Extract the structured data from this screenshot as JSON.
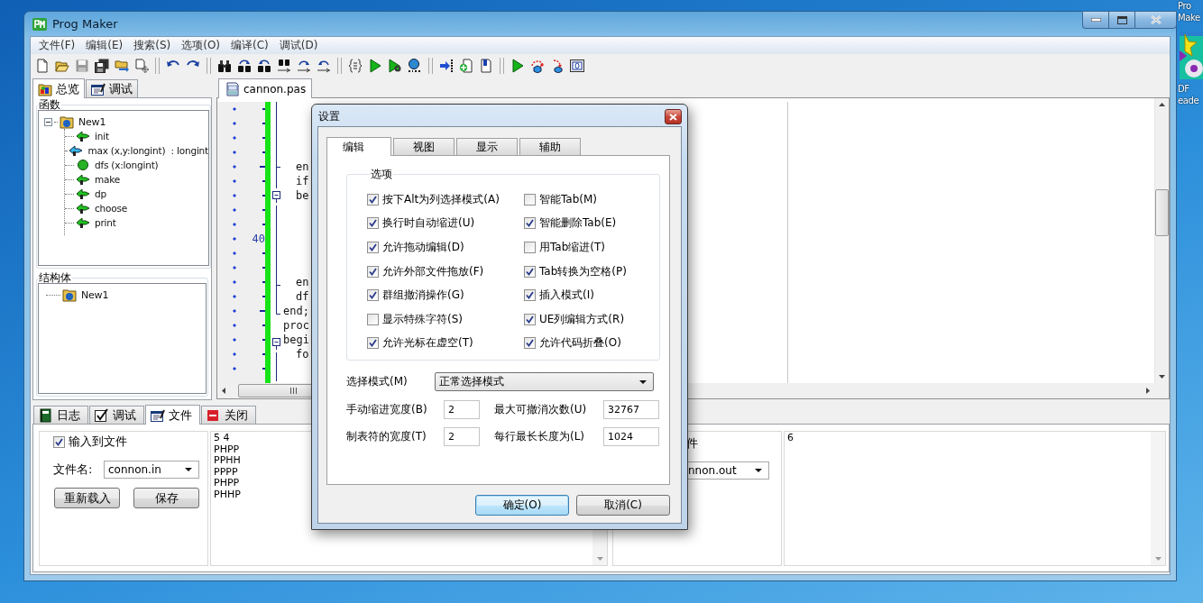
{
  "desktop": {
    "icons": [
      {
        "lines": [
          "Pro",
          "Make"
        ],
        "kind": "text"
      },
      {
        "lines": [
          "DF",
          "eade"
        ],
        "kind": "app"
      }
    ]
  },
  "window": {
    "title": "Prog Maker"
  },
  "menu": [
    "文件(F)",
    "编辑(E)",
    "搜索(S)",
    "选项(O)",
    "编译(C)",
    "调试(D)"
  ],
  "toolbar": [
    [
      {
        "kind": "new",
        "disabled": false
      },
      {
        "kind": "open",
        "disabled": false
      },
      {
        "kind": "save",
        "disabled": true
      },
      {
        "kind": "saveall",
        "disabled": false
      },
      {
        "kind": "export",
        "disabled": false
      },
      {
        "kind": "pagecursor",
        "disabled": false
      }
    ],
    [
      {
        "kind": "undo",
        "disabled": false
      },
      {
        "kind": "redo",
        "disabled": false
      }
    ],
    [
      {
        "kind": "find",
        "disabled": false
      },
      {
        "kind": "findnext",
        "disabled": false
      },
      {
        "kind": "findprev",
        "disabled": false
      },
      {
        "kind": "replace",
        "disabled": false
      },
      {
        "kind": "replacenext",
        "disabled": false
      },
      {
        "kind": "replaceprev",
        "disabled": false
      }
    ],
    [
      {
        "kind": "format",
        "disabled": false
      },
      {
        "kind": "run",
        "disabled": false
      },
      {
        "kind": "compile",
        "disabled": false
      },
      {
        "kind": "build",
        "disabled": false
      }
    ],
    [
      {
        "kind": "stepin",
        "disabled": false
      },
      {
        "kind": "addpage",
        "disabled": false
      },
      {
        "kind": "bookmark",
        "disabled": false
      }
    ],
    [
      {
        "kind": "run",
        "disabled": false
      },
      {
        "kind": "stepover",
        "disabled": false
      },
      {
        "kind": "stepdown",
        "disabled": false
      },
      {
        "kind": "window",
        "disabled": false
      }
    ]
  ],
  "left_panel": {
    "tabs": [
      {
        "label": "总览",
        "kind": "overview",
        "selected": true
      },
      {
        "label": "调试",
        "kind": "debug",
        "selected": false
      }
    ],
    "groups": [
      {
        "title": "函数",
        "tree": [
          {
            "label": "New1",
            "expanded": true,
            "children": [
              {
                "label": "init",
                "kind": "procedure"
              },
              {
                "label": "max (x,y:longint)  : longint",
                "kind": "function"
              },
              {
                "label": "dfs (x:longint)",
                "kind": "forward"
              },
              {
                "label": "make",
                "kind": "procedure"
              },
              {
                "label": "dp",
                "kind": "procedure"
              },
              {
                "label": "choose",
                "kind": "procedure"
              },
              {
                "label": "print",
                "kind": "procedure"
              }
            ]
          }
        ]
      },
      {
        "title": "结构体",
        "tree": [
          {
            "label": "New1"
          }
        ]
      }
    ]
  },
  "editor": {
    "tabs": [
      {
        "label": "cannon.pas",
        "selected": true
      }
    ],
    "lines": [
      {
        "long_dash": false,
        "kind": "inner"
      },
      {
        "long_dash": false,
        "kind": "inner"
      },
      {
        "long_dash": false,
        "kind": "inner"
      },
      {
        "long_dash": false,
        "kind": "inner"
      },
      {
        "long_dash": true,
        "kind": "branch",
        "text": "en",
        "indented": true
      },
      {
        "long_dash": false,
        "kind": "inner",
        "text": "if",
        "indented": true
      },
      {
        "long_dash": false,
        "kind": "foldstart",
        "text": "be",
        "indented": true
      },
      {
        "long_dash": false,
        "kind": "inner"
      },
      {
        "long_dash": false,
        "kind": "inner"
      },
      {
        "number": "40",
        "kind": "inner"
      },
      {
        "long_dash": false,
        "kind": "inner"
      },
      {
        "long_dash": false,
        "kind": "inner"
      },
      {
        "long_dash": false,
        "kind": "branch",
        "text": "en",
        "indented": true
      },
      {
        "long_dash": false,
        "kind": "inner",
        "text": "df",
        "indented": true
      },
      {
        "long_dash": true,
        "kind": "foldend",
        "text": "end;",
        "indented": false
      },
      {
        "long_dash": false,
        "kind": "plain",
        "text": "proc",
        "indented": false
      },
      {
        "long_dash": false,
        "kind": "foldstart",
        "text": "begi",
        "indented": false
      },
      {
        "long_dash": false,
        "kind": "inner",
        "text": "fo",
        "indented": true
      },
      {
        "long_dash": false,
        "kind": "inner"
      }
    ]
  },
  "bottom_panel": {
    "tabs": [
      {
        "label": "日志",
        "kind": "log",
        "selected": false
      },
      {
        "label": "调试",
        "kind": "debug",
        "selected": false
      },
      {
        "label": "文件",
        "kind": "file",
        "selected": true
      },
      {
        "label": "关闭",
        "kind": "close",
        "selected": false
      }
    ],
    "input": {
      "checkbox": {
        "label": "输入到文件",
        "checked": true
      },
      "filename_label": "文件名:",
      "filename": "connon.in",
      "buttons": [
        "重新载入",
        "保存"
      ],
      "content": [
        "5 4",
        "PHPP",
        "PPHH",
        "PPPP",
        "PHPP",
        "PHHP"
      ]
    },
    "output": {
      "label": "件",
      "filename": "nnon.out",
      "content": [
        "6"
      ]
    }
  },
  "dialog": {
    "title": "设置",
    "tabs": [
      {
        "label": "编辑",
        "selected": true
      },
      {
        "label": "视图",
        "selected": false
      },
      {
        "label": "显示",
        "selected": false
      },
      {
        "label": "辅助",
        "selected": false
      }
    ],
    "group_title": "选项",
    "options": [
      {
        "label": "按下Alt为列选择模式(A)",
        "checked": true
      },
      {
        "label": "智能Tab(M)",
        "checked": false
      },
      {
        "label": "换行时自动缩进(U)",
        "checked": true
      },
      {
        "label": "智能删除Tab(E)",
        "checked": true
      },
      {
        "label": "允许拖动编辑(D)",
        "checked": true
      },
      {
        "label": "用Tab缩进(T)",
        "checked": false
      },
      {
        "label": "允许外部文件拖放(F)",
        "checked": true
      },
      {
        "label": "Tab转换为空格(P)",
        "checked": true
      },
      {
        "label": "群组撤消操作(G)",
        "checked": true
      },
      {
        "label": "插入模式(I)",
        "checked": true
      },
      {
        "label": "显示特殊字符(S)",
        "checked": false
      },
      {
        "label": "UE列编辑方式(R)",
        "checked": true
      },
      {
        "label": "允许光标在虚空(T)",
        "checked": true
      },
      {
        "label": "允许代码折叠(O)",
        "checked": true
      }
    ],
    "select_mode": {
      "label": "选择模式(M)",
      "value": "正常选择模式"
    },
    "fields": [
      {
        "label": "手动缩进宽度(B)",
        "value": "2"
      },
      {
        "label": "最大可撤消次数(U)",
        "value": "32767"
      },
      {
        "label": "制表符的宽度(T)",
        "value": "2"
      },
      {
        "label": "每行最长长度为(L)",
        "value": "1024"
      }
    ],
    "buttons": [
      {
        "label": "确定(O)",
        "default": true
      },
      {
        "label": "取消(C)",
        "default": false
      }
    ]
  }
}
